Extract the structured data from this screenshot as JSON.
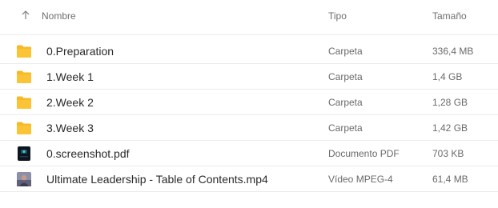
{
  "header": {
    "name_label": "Nombre",
    "type_label": "Tipo",
    "size_label": "Tamaño",
    "sort_icon": "arrow-up-icon"
  },
  "colors": {
    "folder": "#f7b928",
    "text": "#2a2a2a",
    "muted": "#6a6a6a",
    "divider": "#ececec"
  },
  "files": [
    {
      "name": "0.Preparation",
      "type": "Carpeta",
      "size": "336,4 MB",
      "icon": "folder-icon"
    },
    {
      "name": "1.Week 1",
      "type": "Carpeta",
      "size": "1,4 GB",
      "icon": "folder-icon"
    },
    {
      "name": "2.Week 2",
      "type": "Carpeta",
      "size": "1,28 GB",
      "icon": "folder-icon"
    },
    {
      "name": "3.Week 3",
      "type": "Carpeta",
      "size": "1,42 GB",
      "icon": "folder-icon"
    },
    {
      "name": "0.screenshot.pdf",
      "type": "Documento PDF",
      "size": "703 KB",
      "icon": "pdf-thumbnail-icon"
    },
    {
      "name": "Ultimate Leadership - Table of Contents.mp4",
      "type": "Vídeo MPEG-4",
      "size": "61,4 MB",
      "icon": "video-thumbnail-icon"
    }
  ]
}
